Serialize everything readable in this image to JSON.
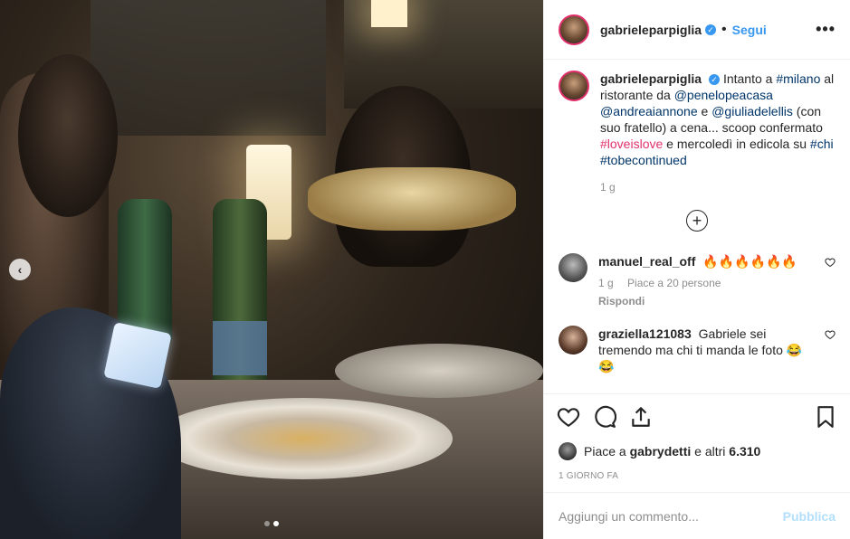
{
  "post": {
    "username": "gabrieleparpiglia",
    "follow_label": "Segui",
    "more_label": "•••",
    "caption_parts": [
      {
        "t": "Intanto a ",
        "k": "text"
      },
      {
        "t": "#milano",
        "k": "tag"
      },
      {
        "t": " al ristorante da ",
        "k": "text"
      },
      {
        "t": "@penelopeacasa",
        "k": "tag"
      },
      {
        "t": " ",
        "k": "text"
      },
      {
        "t": "@andreaiannone",
        "k": "tag"
      },
      {
        "t": " e ",
        "k": "text"
      },
      {
        "t": "@giuliadelellis",
        "k": "tag"
      },
      {
        "t": " (con suo fratello) a cena... scoop confermato ",
        "k": "text"
      },
      {
        "t": "#loveislove",
        "k": "rainbow"
      },
      {
        "t": " e mercoledì in edicola su ",
        "k": "text"
      },
      {
        "t": "#chi",
        "k": "tag"
      },
      {
        "t": " ",
        "k": "text"
      },
      {
        "t": "#tobecontinued",
        "k": "tag"
      }
    ],
    "caption_age": "1 g",
    "load_more": "+"
  },
  "comments": [
    {
      "username": "manuel_real_off",
      "text": "🔥🔥🔥🔥🔥🔥",
      "age": "1 g",
      "likes": "Piace a 20 persone",
      "reply": "Rispondi"
    },
    {
      "username": "graziella121083",
      "text": "Gabriele sei tremendo ma chi ti manda le foto 😂😂"
    }
  ],
  "likes_summary": {
    "prefix": "Piace a ",
    "user": "gabrydetti",
    "suffix": " e altri ",
    "count": "6.310"
  },
  "posted": "1 giorno fa",
  "add_comment": {
    "placeholder": "Aggiungi un commento...",
    "publish": "Pubblica"
  },
  "colors": {
    "accent": "#3897f0",
    "hashtag": "#003569",
    "publish_disabled": "#b2dffc"
  }
}
